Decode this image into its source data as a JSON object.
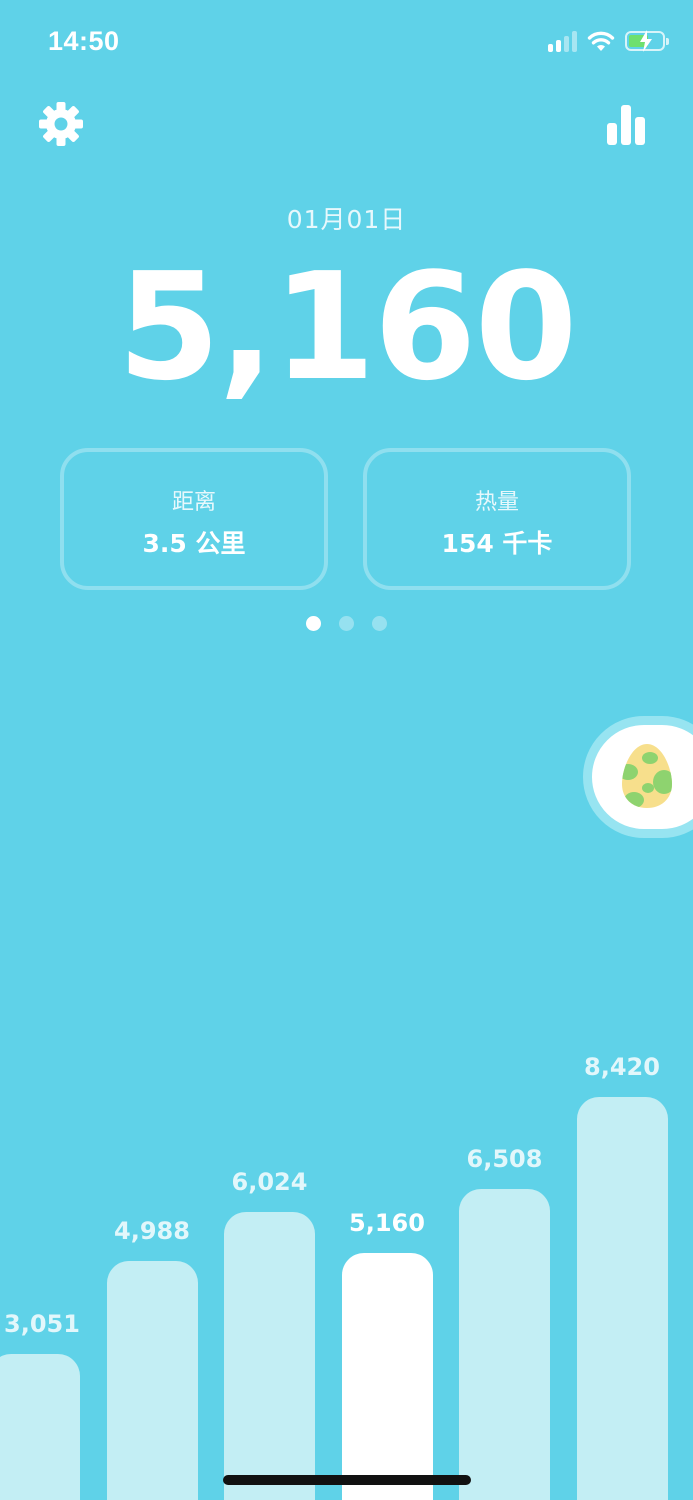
{
  "status_bar": {
    "time": "14:50",
    "icons": [
      "signal-icon",
      "wifi-icon",
      "battery-charging-icon"
    ]
  },
  "header": {
    "left_icon": "gear-icon",
    "right_icon": "bar-chart-icon"
  },
  "date": "01月01日",
  "steps": "5,160",
  "cards": [
    {
      "label": "距离",
      "value": "3.5 公里"
    },
    {
      "label": "热量",
      "value": "154 千卡"
    }
  ],
  "pager": {
    "count": 3,
    "active": 0
  },
  "egg_button": {
    "icon": "egg-icon"
  },
  "chart_data": {
    "type": "bar",
    "values": [
      3051,
      4988,
      6024,
      5160,
      6508,
      8420
    ],
    "labels": [
      "3,051",
      "4,988",
      "6,024",
      "5,160",
      "6,508",
      "8,420"
    ],
    "highlight_index": 3,
    "colors": {
      "bar": "#c3eef4",
      "highlight": "#ffffff",
      "background": "#5fd2e8"
    }
  }
}
